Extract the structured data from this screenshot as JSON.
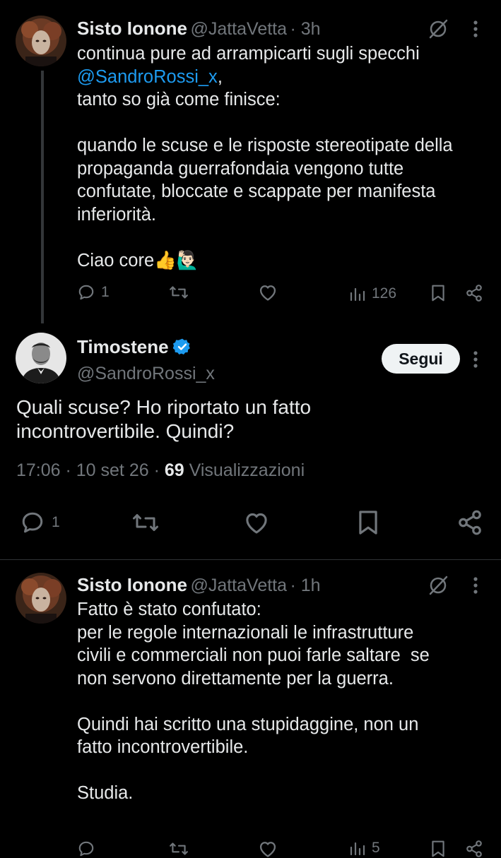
{
  "tweet1": {
    "name": "Sisto Ionone",
    "handle": "@JattaVetta",
    "time": "· 3h",
    "line1": "continua pure ad arrampicarti sugli specchi",
    "mention": "@SandroRossi_x",
    "line1_suffix": ",",
    "text_rest": "tanto so già come finisce:\n\nquando le scuse e le risposte stereotipate della\npropaganda guerrafondaia vengono tutte\nconfutate, bloccate e scappate per manifesta\ninferiorità.\n\nCiao core👍🙋🏻‍♂️",
    "replies": "1",
    "views": "126"
  },
  "main_tweet": {
    "name": "Timostene",
    "handle": "@SandroRossi_x",
    "follow_label": "Segui",
    "text": "Quali scuse? Ho riportato un fatto\nincontrovertibile. Quindi?",
    "time_date": "17:06 · 10 set 26 · ",
    "views_count": "69",
    "views_label": " Visualizzazioni",
    "replies": "1"
  },
  "tweet3": {
    "name": "Sisto Ionone",
    "handle": "@JattaVetta",
    "time": "· 1h",
    "text": "Fatto è stato confutato:\nper le regole internazionali le infrastrutture\ncivili e commerciali non puoi farle saltare  se\nnon servono direttamente per la guerra.\n\nQuindi hai scritto una stupidaggine, non un\nfatto incontrovertibile.\n\nStudia.",
    "replies": "",
    "views": "5"
  },
  "colors": {
    "background": "#000000",
    "text": "#e7e9ea",
    "gray": "#71767b",
    "link": "#1d9bf0",
    "verified": "#1d9bf0"
  }
}
